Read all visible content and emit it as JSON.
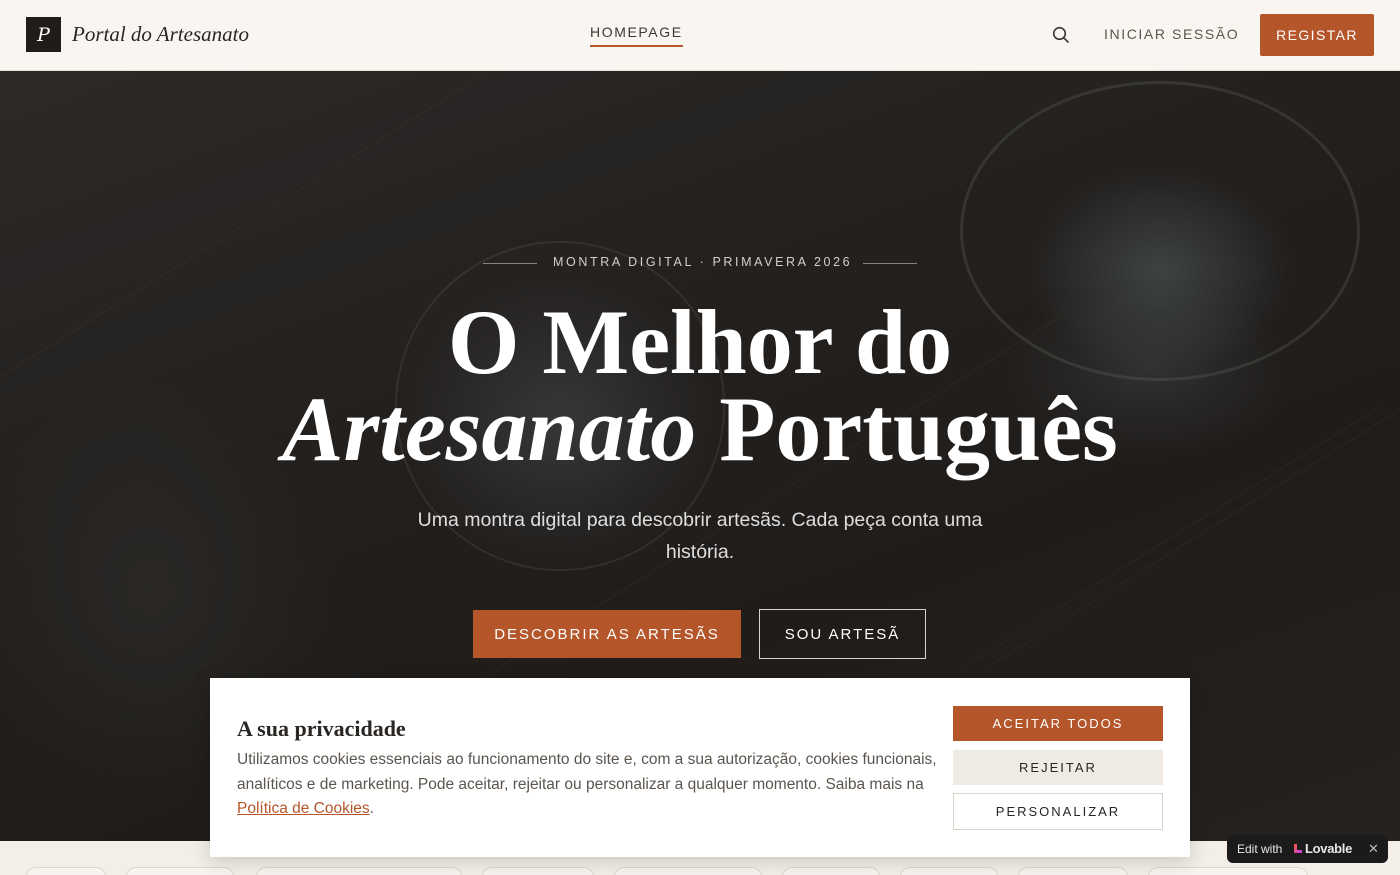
{
  "header": {
    "logo_letter": "P",
    "logo_text": "Portal do Artesanato",
    "nav_home": "HOMEPAGE",
    "search_icon": "search-icon",
    "login_label": "INICIAR SESSÃO",
    "register_label": "REGISTAR"
  },
  "hero": {
    "eyebrow": "MONTRA DIGITAL · PRIMAVERA 2026",
    "title_line1": "O Melhor do",
    "title_line2_italic": "Artesanato",
    "title_line2_rest": "Português",
    "subtitle": "Uma montra digital para descobrir artesãs. Cada peça conta uma história.",
    "primary_button": "DESCOBRIR AS ARTESÃS",
    "secondary_button": "SOU ARTESÃ"
  },
  "cookie_banner": {
    "title": "A sua privacidade",
    "text": "Utilizamos cookies essenciais ao funcionamento do site e, com a sua autorização, cookies funcionais, analíticos e de marketing. Pode aceitar, rejeitar ou personalizar a qualquer momento. Saiba mais na ",
    "link_text": "Política de Cookies",
    "text_end": ".",
    "accept_label": "ACEITAR TODOS",
    "reject_label": "REJEITAR",
    "customize_label": "PERSONALIZAR"
  },
  "lovable_badge": {
    "edit_label": "Edit with",
    "brand": "Lovable",
    "close_icon": "close-icon"
  },
  "colors": {
    "accent": "#b5552a",
    "header_bg": "#f9f6f1",
    "dark": "#1f1c19"
  }
}
